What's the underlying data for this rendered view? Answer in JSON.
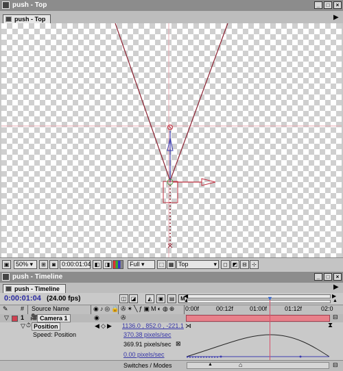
{
  "comp_window": {
    "title": "push - Top",
    "tab_label": "push - Top",
    "window_buttons": [
      "_",
      "□",
      "×"
    ]
  },
  "comp_toolbar": {
    "zoom": "50%",
    "timecode": "0:00:01:04",
    "resolution": "Full",
    "view": "Top"
  },
  "timeline_window": {
    "title": "push - Timeline",
    "tab_label": "push - Timeline",
    "window_buttons": [
      "_",
      "□",
      "×"
    ]
  },
  "timeline": {
    "current_time": "0:00:01:04",
    "fps": "(24.00 fps)",
    "column_headers": {
      "layer_num": "#",
      "source_name": "Source Name"
    },
    "ruler_labels": [
      "0:00f",
      "00:12f",
      "01:00f",
      "01:12f",
      "02:0"
    ],
    "layer": {
      "number": "1",
      "name": "Camera 1",
      "property": "Position",
      "property_value": "1136.0 , 852.0 , -221.1",
      "speed_label": "Speed: Position",
      "speed_top": "370.38 pixels/sec",
      "speed_current": "369.91 pixels/sec",
      "speed_bottom": "0.00 pixels/sec"
    },
    "bottom_label": "Switches / Modes",
    "switch_letter": "M"
  },
  "colors": {
    "window_bg": "#c9c9c9",
    "titlebar": "#8c8c8c",
    "camera_line": "#8a2030",
    "axis_blue": "#3a3ab0",
    "layer_bar": "#e8808a",
    "time_marker": "#d8506a",
    "timecode_blue": "#2a2aa0"
  },
  "speed_graph": {
    "y_axis_label": "pixels/sec",
    "y_max": 370.38,
    "y_min": 0.0,
    "current_value": 369.91
  }
}
